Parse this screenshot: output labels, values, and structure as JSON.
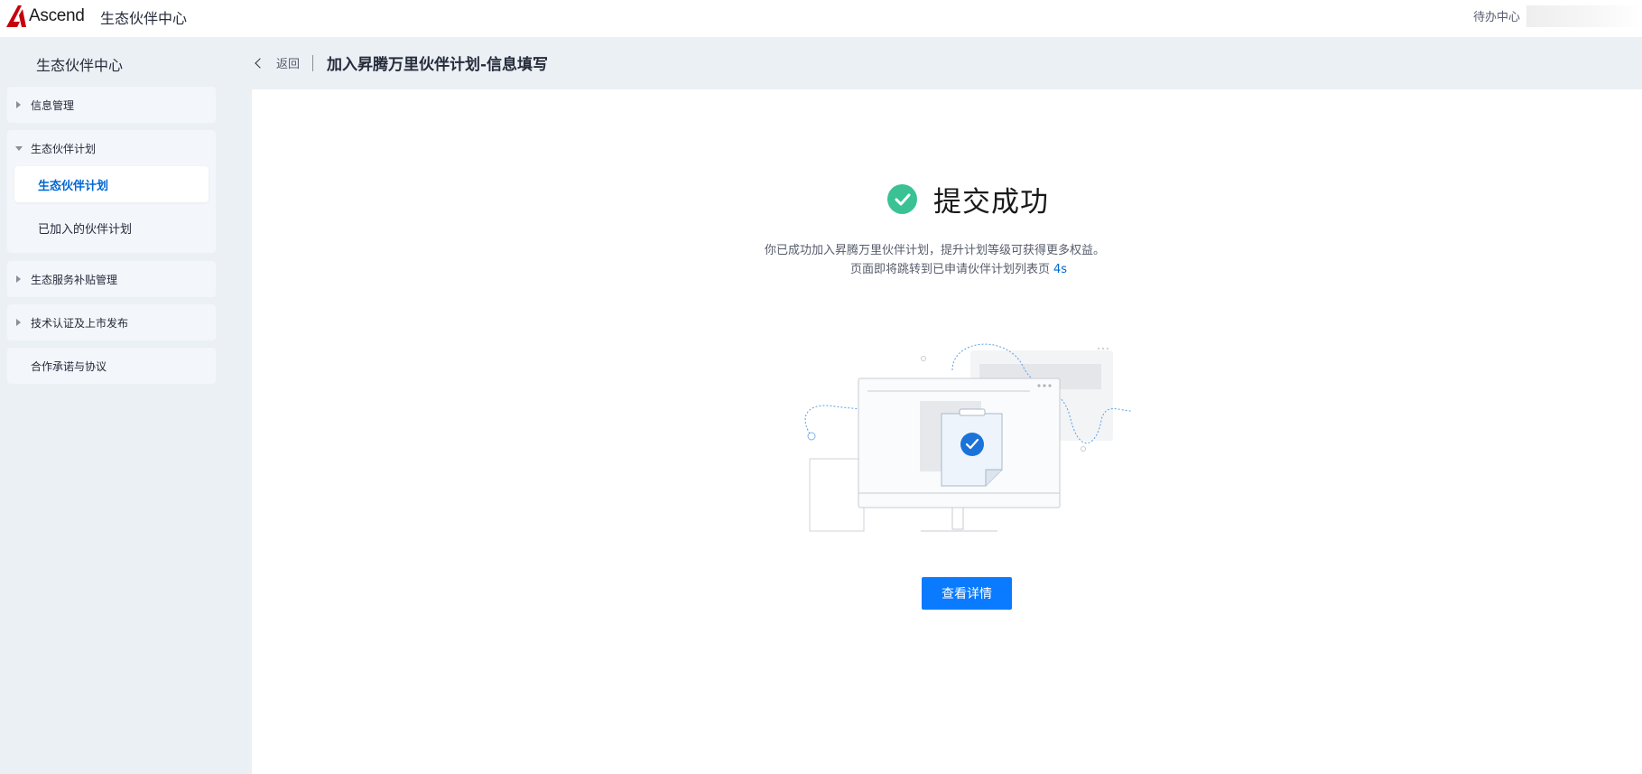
{
  "topbar": {
    "logo_text": "Ascend",
    "app_title": "生态伙伴中心",
    "todo_label": "待办中心"
  },
  "sidebar": {
    "title": "生态伙伴中心",
    "groups": [
      {
        "label": "信息管理",
        "expanded": false
      },
      {
        "label": "生态伙伴计划",
        "expanded": true,
        "items": [
          {
            "label": "生态伙伴计划",
            "active": true
          },
          {
            "label": "已加入的伙伴计划",
            "active": false
          }
        ]
      },
      {
        "label": "生态服务补贴管理",
        "expanded": false
      },
      {
        "label": "技术认证及上市发布",
        "expanded": false
      },
      {
        "label": "合作承诺与协议",
        "expanded": false
      }
    ]
  },
  "header": {
    "back_label": "返回",
    "page_title": "加入昇腾万里伙伴计划-信息填写"
  },
  "result": {
    "title": "提交成功",
    "message": "你已成功加入昇腾万里伙伴计划，提升计划等级可获得更多权益。",
    "redirect_text": "页面即将跳转到已申请伙伴计划列表页",
    "countdown": "4s",
    "detail_button": "查看详情"
  },
  "colors": {
    "brand": "#0a7bff",
    "active_text": "#0067d1",
    "success": "#3ac295",
    "sidebar_bg": "#ebf0f5",
    "logo_red": "#c7000b"
  }
}
